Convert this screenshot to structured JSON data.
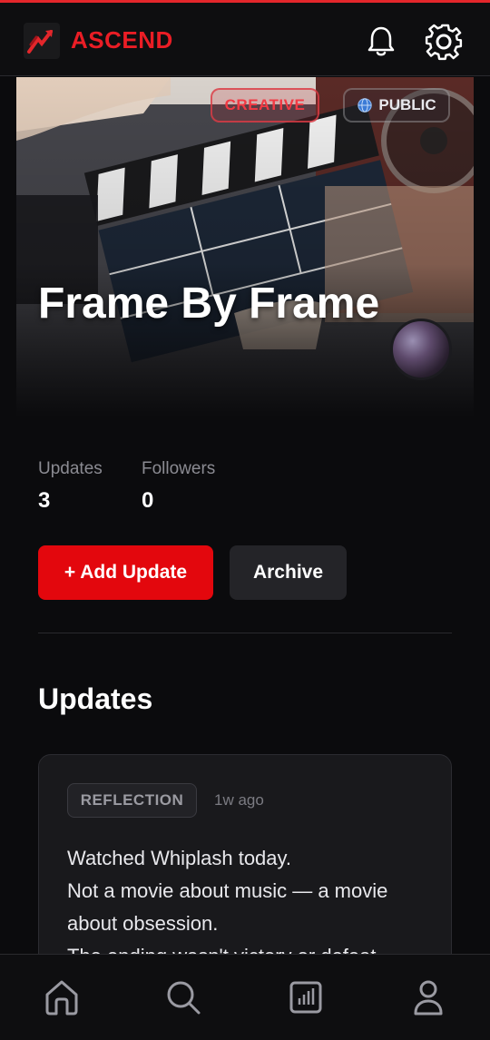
{
  "header": {
    "brand": "ASCEND",
    "logo_icon": "ascend-logo-icon",
    "notification_icon": "bell-icon",
    "settings_icon": "gear-icon",
    "accent_color": "#ea1d25"
  },
  "hero": {
    "title": "Frame By Frame",
    "category_tag": "CREATIVE",
    "visibility_tag": "PUBLIC",
    "visibility_icon": "globe-icon",
    "avatar": "avatar"
  },
  "stats": [
    {
      "label": "Updates",
      "value": "3"
    },
    {
      "label": "Followers",
      "value": "0"
    }
  ],
  "actions": {
    "add_update_label": "+ Add Update",
    "archive_label": "Archive"
  },
  "updates_section": {
    "title": "Updates",
    "items": [
      {
        "tag": "REFLECTION",
        "time": "1w ago",
        "text": "Watched Whiplash today.\nNot a movie about music — a movie about obsession.\nThe ending wasn't victory or defeat"
      }
    ]
  },
  "bottom_nav": [
    {
      "icon": "home-icon"
    },
    {
      "icon": "search-icon"
    },
    {
      "icon": "stats-icon"
    },
    {
      "icon": "profile-icon"
    }
  ]
}
